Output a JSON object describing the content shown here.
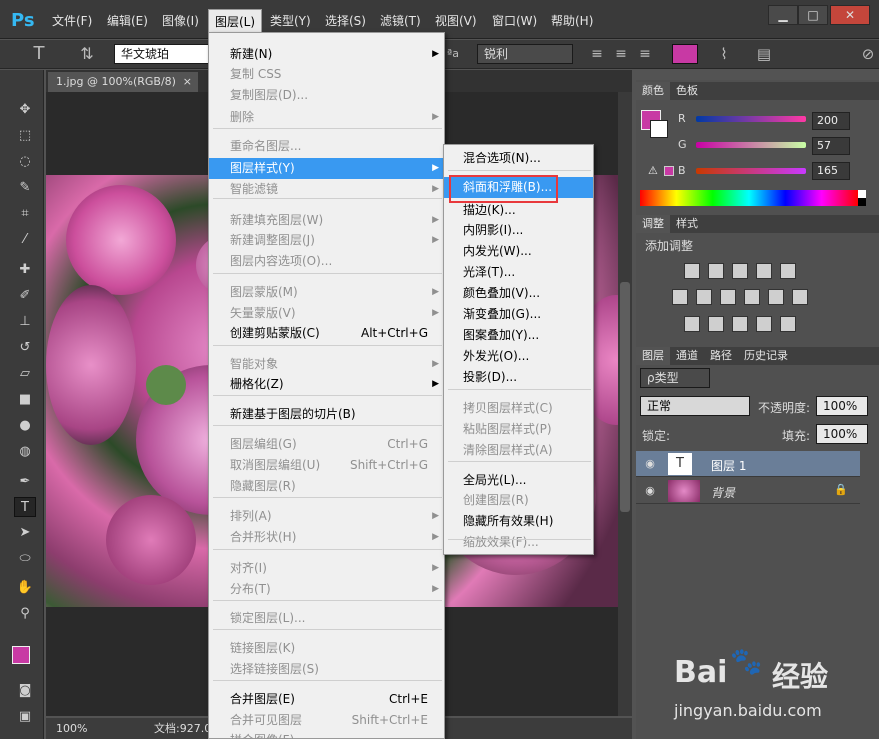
{
  "app": {
    "logo": "Ps"
  },
  "menubar": {
    "items": [
      "文件(F)",
      "编辑(E)",
      "图像(I)",
      "图层(L)",
      "类型(Y)",
      "选择(S)",
      "滤镜(T)",
      "视图(V)",
      "窗口(W)",
      "帮助(H)"
    ]
  },
  "window_controls": {
    "minimize": "▁",
    "maximize": "□",
    "close": "✕"
  },
  "options": {
    "font_family": "华文琥珀",
    "aa_label": "ªa",
    "aa_value": "锐利",
    "text_color": "#c839a4"
  },
  "document": {
    "tab": "1.jpg @ 100%(RGB/8)",
    "close": "×",
    "zoom": "100%",
    "doc_info": "文档:927.0"
  },
  "layer_menu": {
    "items": [
      {
        "label": "新建(N)",
        "shortcut": "",
        "arrow": true,
        "disabled": false
      },
      {
        "label": "复制 CSS",
        "shortcut": "",
        "arrow": false,
        "disabled": true
      },
      {
        "label": "复制图层(D)...",
        "shortcut": "",
        "arrow": false,
        "disabled": true
      },
      {
        "label": "删除",
        "shortcut": "",
        "arrow": true,
        "disabled": true
      },
      {
        "label": "重命名图层...",
        "shortcut": "",
        "arrow": false,
        "disabled": true
      },
      {
        "label": "图层样式(Y)",
        "shortcut": "",
        "arrow": true,
        "disabled": false,
        "highlight": true
      },
      {
        "label": "智能滤镜",
        "shortcut": "",
        "arrow": true,
        "disabled": true
      },
      {
        "label": "新建填充图层(W)",
        "shortcut": "",
        "arrow": true,
        "disabled": true
      },
      {
        "label": "新建调整图层(J)",
        "shortcut": "",
        "arrow": true,
        "disabled": true
      },
      {
        "label": "图层内容选项(O)...",
        "shortcut": "",
        "arrow": false,
        "disabled": true
      },
      {
        "label": "图层蒙版(M)",
        "shortcut": "",
        "arrow": true,
        "disabled": true
      },
      {
        "label": "矢量蒙版(V)",
        "shortcut": "",
        "arrow": true,
        "disabled": true
      },
      {
        "label": "创建剪贴蒙版(C)",
        "shortcut": "Alt+Ctrl+G",
        "arrow": false,
        "disabled": false
      },
      {
        "label": "智能对象",
        "shortcut": "",
        "arrow": true,
        "disabled": true
      },
      {
        "label": "栅格化(Z)",
        "shortcut": "",
        "arrow": true,
        "disabled": false
      },
      {
        "label": "新建基于图层的切片(B)",
        "shortcut": "",
        "arrow": false,
        "disabled": false
      },
      {
        "label": "图层编组(G)",
        "shortcut": "Ctrl+G",
        "arrow": false,
        "disabled": true
      },
      {
        "label": "取消图层编组(U)",
        "shortcut": "Shift+Ctrl+G",
        "arrow": false,
        "disabled": true
      },
      {
        "label": "隐藏图层(R)",
        "shortcut": "",
        "arrow": false,
        "disabled": true
      },
      {
        "label": "排列(A)",
        "shortcut": "",
        "arrow": true,
        "disabled": true
      },
      {
        "label": "合并形状(H)",
        "shortcut": "",
        "arrow": true,
        "disabled": true
      },
      {
        "label": "对齐(I)",
        "shortcut": "",
        "arrow": true,
        "disabled": true
      },
      {
        "label": "分布(T)",
        "shortcut": "",
        "arrow": true,
        "disabled": true
      },
      {
        "label": "锁定图层(L)...",
        "shortcut": "",
        "arrow": false,
        "disabled": true
      },
      {
        "label": "链接图层(K)",
        "shortcut": "",
        "arrow": false,
        "disabled": true
      },
      {
        "label": "选择链接图层(S)",
        "shortcut": "",
        "arrow": false,
        "disabled": true
      },
      {
        "label": "合并图层(E)",
        "shortcut": "Ctrl+E",
        "arrow": false,
        "disabled": false
      },
      {
        "label": "合并可见图层",
        "shortcut": "Shift+Ctrl+E",
        "arrow": false,
        "disabled": true
      },
      {
        "label": "拼合图像(F)",
        "shortcut": "",
        "arrow": false,
        "disabled": true
      }
    ]
  },
  "style_submenu": {
    "items": [
      {
        "label": "混合选项(N)...",
        "disabled": false
      },
      {
        "label": "斜面和浮雕(B)...",
        "disabled": false,
        "highlight": true
      },
      {
        "label": "描边(K)...",
        "disabled": false
      },
      {
        "label": "内阴影(I)...",
        "disabled": false
      },
      {
        "label": "内发光(W)...",
        "disabled": false
      },
      {
        "label": "光泽(T)...",
        "disabled": false
      },
      {
        "label": "颜色叠加(V)...",
        "disabled": false
      },
      {
        "label": "渐变叠加(G)...",
        "disabled": false
      },
      {
        "label": "图案叠加(Y)...",
        "disabled": false
      },
      {
        "label": "外发光(O)...",
        "disabled": false
      },
      {
        "label": "投影(D)...",
        "disabled": false
      },
      {
        "label": "拷贝图层样式(C)",
        "disabled": true
      },
      {
        "label": "粘贴图层样式(P)",
        "disabled": true
      },
      {
        "label": "清除图层样式(A)",
        "disabled": true
      },
      {
        "label": "全局光(L)...",
        "disabled": false
      },
      {
        "label": "创建图层(R)",
        "disabled": true
      },
      {
        "label": "隐藏所有效果(H)",
        "disabled": false
      },
      {
        "label": "缩放效果(F)...",
        "disabled": true
      }
    ]
  },
  "color_panel": {
    "tabs": [
      "颜色",
      "色板"
    ],
    "r_label": "R",
    "g_label": "G",
    "b_label": "B",
    "r": "200",
    "g": "57",
    "b": "165"
  },
  "adjust_panel": {
    "tabs": [
      "调整",
      "样式"
    ],
    "title": "添加调整"
  },
  "layers_panel": {
    "tabs": [
      "图层",
      "通道",
      "路径",
      "历史记录"
    ],
    "filter": "ρ类型",
    "blend": "正常",
    "opacity_label": "不透明度:",
    "opacity": "100%",
    "lock_label": "锁定:",
    "fill_label": "填充:",
    "fill": "100%",
    "layers": [
      {
        "name": "图层 1",
        "thumb": "T"
      },
      {
        "name": "背景"
      }
    ]
  },
  "watermark": {
    "brand_a": "Bai",
    "brand_b": "经验",
    "url": "jingyan.baidu.com"
  }
}
